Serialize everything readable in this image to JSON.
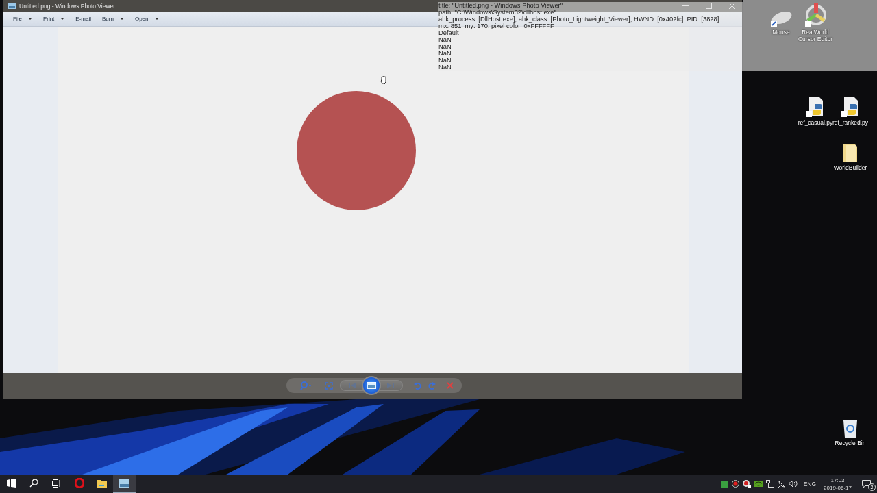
{
  "window": {
    "title": "Untitled.png - Windows Photo Viewer",
    "menu": [
      {
        "label": "File",
        "dropdown": true
      },
      {
        "label": "Print",
        "dropdown": true
      },
      {
        "label": "E-mail",
        "dropdown": false
      },
      {
        "label": "Burn",
        "dropdown": true
      },
      {
        "label": "Open",
        "dropdown": true
      }
    ],
    "controls": [
      {
        "kind": "zoom",
        "disabled": false
      },
      {
        "kind": "fit",
        "disabled": false
      },
      {
        "kind": "previous",
        "disabled": true
      },
      {
        "kind": "slideshow",
        "disabled": false
      },
      {
        "kind": "next",
        "disabled": true
      },
      {
        "kind": "rotate-left",
        "disabled": false
      },
      {
        "kind": "rotate-right",
        "disabled": false
      },
      {
        "kind": "delete",
        "disabled": false
      }
    ]
  },
  "tooltip": {
    "lines": [
      "title: \"Untitled.png - Windows Photo Viewer\"",
      "path: \"C:\\Windows\\System32\\dllhost.exe\"",
      "ahk_process: [DllHost.exe], ahk_class: [Photo_Lightweight_Viewer], HWND: [0x402fc], PID: [3828]",
      "mx: 851, my: 170, pixel color: 0xFFFFFF",
      "Default",
      "NaN",
      "NaN",
      "NaN",
      "NaN",
      "NaN"
    ]
  },
  "desktop_icons": [
    {
      "label": "Mouse",
      "kind": "mouse"
    },
    {
      "label": "RealWorld Cursor Editor",
      "kind": "cursor-editor"
    },
    {
      "label": "ref_casual.py",
      "kind": "python"
    },
    {
      "label": "ref_ranked.py",
      "kind": "python"
    },
    {
      "label": "WorldBuilder",
      "kind": "folder"
    },
    {
      "label": "Recycle Bin",
      "kind": "recycle"
    }
  ],
  "taskbar": {
    "apps": [
      {
        "kind": "start",
        "active": false
      },
      {
        "kind": "search",
        "active": false
      },
      {
        "kind": "task-view",
        "active": false
      },
      {
        "kind": "opera",
        "active": false
      },
      {
        "kind": "explorer",
        "active": false
      },
      {
        "kind": "photo-viewer",
        "active": true
      }
    ],
    "tray": [
      {
        "kind": "h-app"
      },
      {
        "kind": "record"
      },
      {
        "kind": "record-app"
      },
      {
        "kind": "nvidia"
      },
      {
        "kind": "network"
      },
      {
        "kind": "wifi"
      },
      {
        "kind": "volume"
      }
    ],
    "language": "ENG",
    "time": "17:03",
    "date": "2019-06-17",
    "notifications": "2"
  }
}
